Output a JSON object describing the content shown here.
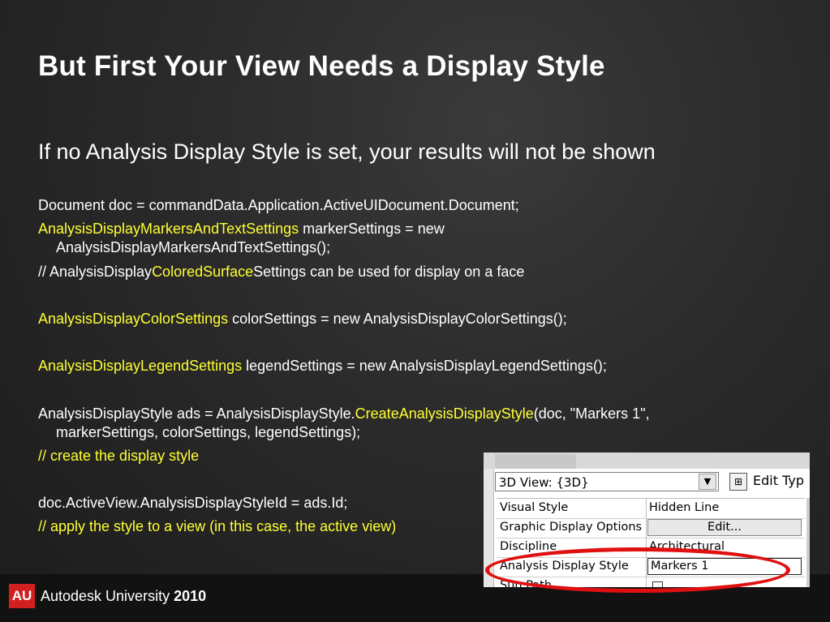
{
  "slide": {
    "title": "But First Your View Needs a Display Style",
    "subtitle": "If no Analysis Display Style is set, your results will not be shown"
  },
  "code": {
    "l1": "Document doc = commandData.Application.ActiveUIDocument.Document;",
    "l2_type": "AnalysisDisplayMarkersAndTextSettings",
    "l2_rest": " markerSettings = new",
    "l2b": "AnalysisDisplayMarkersAndTextSettings();",
    "l3_a": "// AnalysisDisplay",
    "l3_b": "ColoredSurface",
    "l3_c": "Settings can be used for display on a face",
    "l4_type": "AnalysisDisplayColorSettings",
    "l4_rest": " colorSettings = new AnalysisDisplayColorSettings();",
    "l5_type": "AnalysisDisplayLegendSettings",
    "l5_rest": " legendSettings = new AnalysisDisplayLegendSettings();",
    "l6_a": "AnalysisDisplayStyle ads = AnalysisDisplayStyle.",
    "l6_b": "CreateAnalysisDisplayStyle",
    "l6_c": "(doc, \"Markers 1\",",
    "l6b": "markerSettings, colorSettings, legendSettings);",
    "l7": "// create the display style",
    "l8": "doc.ActiveView.AnalysisDisplayStyleId = ads.Id;",
    "l9": "// apply the style to a view (in this case, the active view)"
  },
  "properties": {
    "view_selector": "3D View: {3D}",
    "edit_type_label": "Edit Typ",
    "rows": [
      {
        "key": "Visual Style",
        "value": "Hidden Line"
      },
      {
        "key": "Graphic Display Options",
        "value": "Edit..."
      },
      {
        "key": "Discipline",
        "value": "Architectural"
      },
      {
        "key": "Analysis Display Style",
        "value": "Markers 1"
      },
      {
        "key": "Sun Path",
        "value": ""
      }
    ]
  },
  "footer": {
    "logo_text": "AU",
    "brand": "Autodesk University",
    "year": "2010"
  },
  "colors": {
    "highlight": "#ffff33",
    "oval": "#e01010",
    "logo": "#d21f1f"
  },
  "icons": {
    "dropdown": "chevron-down-icon",
    "edit_type": "edit-type-icon"
  }
}
